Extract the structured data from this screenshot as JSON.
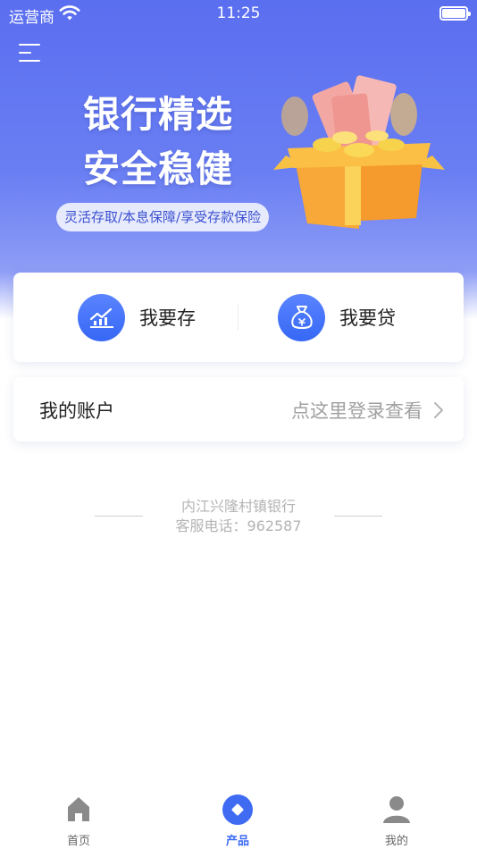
{
  "status_bar": {
    "carrier": "运营商",
    "time": "11:25"
  },
  "hero": {
    "title_line1": "银行精选",
    "title_line2": "安全稳健",
    "tagline": "灵活存取/本息保障/享受存款保险"
  },
  "actions": {
    "deposit_label": "我要存",
    "loan_label": "我要贷"
  },
  "account": {
    "title": "我的账户",
    "login_prompt": "点这里登录查看"
  },
  "footer": {
    "bank_name": "内江兴隆村镇银行",
    "service_phone": "客服电话：962587"
  },
  "tabbar": {
    "active": "产品",
    "tabs": [
      {
        "label": "首页",
        "icon": "home-icon"
      },
      {
        "label": "产品",
        "icon": "product-icon"
      },
      {
        "label": "我的",
        "icon": "user-icon"
      }
    ]
  },
  "colors": {
    "brand_blue": "#3f6bf3",
    "hero_gradient_top": "#5a6ef0",
    "icon_gray": "#8a8a8a"
  }
}
